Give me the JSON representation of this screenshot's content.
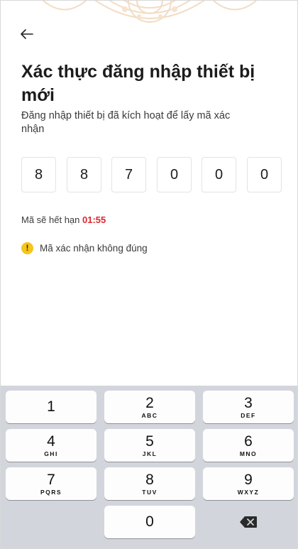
{
  "header": {
    "back_icon": "arrow-left-icon"
  },
  "title": "Xác thực đăng nhập thiết bị mới",
  "subtitle": "Đăng nhập thiết bị đã kích hoạt để lấy mã xác nhận",
  "otp": {
    "digits": [
      "8",
      "8",
      "7",
      "0",
      "0",
      "0"
    ]
  },
  "expiry": {
    "label": "Mã sẽ hết hạn",
    "time": "01:55",
    "time_color": "#e2232b"
  },
  "error": {
    "icon": "warning-icon",
    "icon_symbol": "!",
    "message": "Mã xác nhận không đúng",
    "icon_color": "#f5c518"
  },
  "keypad": {
    "keys": [
      {
        "num": "1",
        "letters": ""
      },
      {
        "num": "2",
        "letters": "ABC"
      },
      {
        "num": "3",
        "letters": "DEF"
      },
      {
        "num": "4",
        "letters": "GHI"
      },
      {
        "num": "5",
        "letters": "JKL"
      },
      {
        "num": "6",
        "letters": "MNO"
      },
      {
        "num": "7",
        "letters": "PQRS"
      },
      {
        "num": "8",
        "letters": "TUV"
      },
      {
        "num": "9",
        "letters": "WXYZ"
      },
      {
        "num": "0",
        "letters": ""
      }
    ],
    "delete_icon": "backspace-icon"
  },
  "colors": {
    "keypad_bg": "#d2d5db",
    "header_pattern": "#f6e3cf"
  }
}
